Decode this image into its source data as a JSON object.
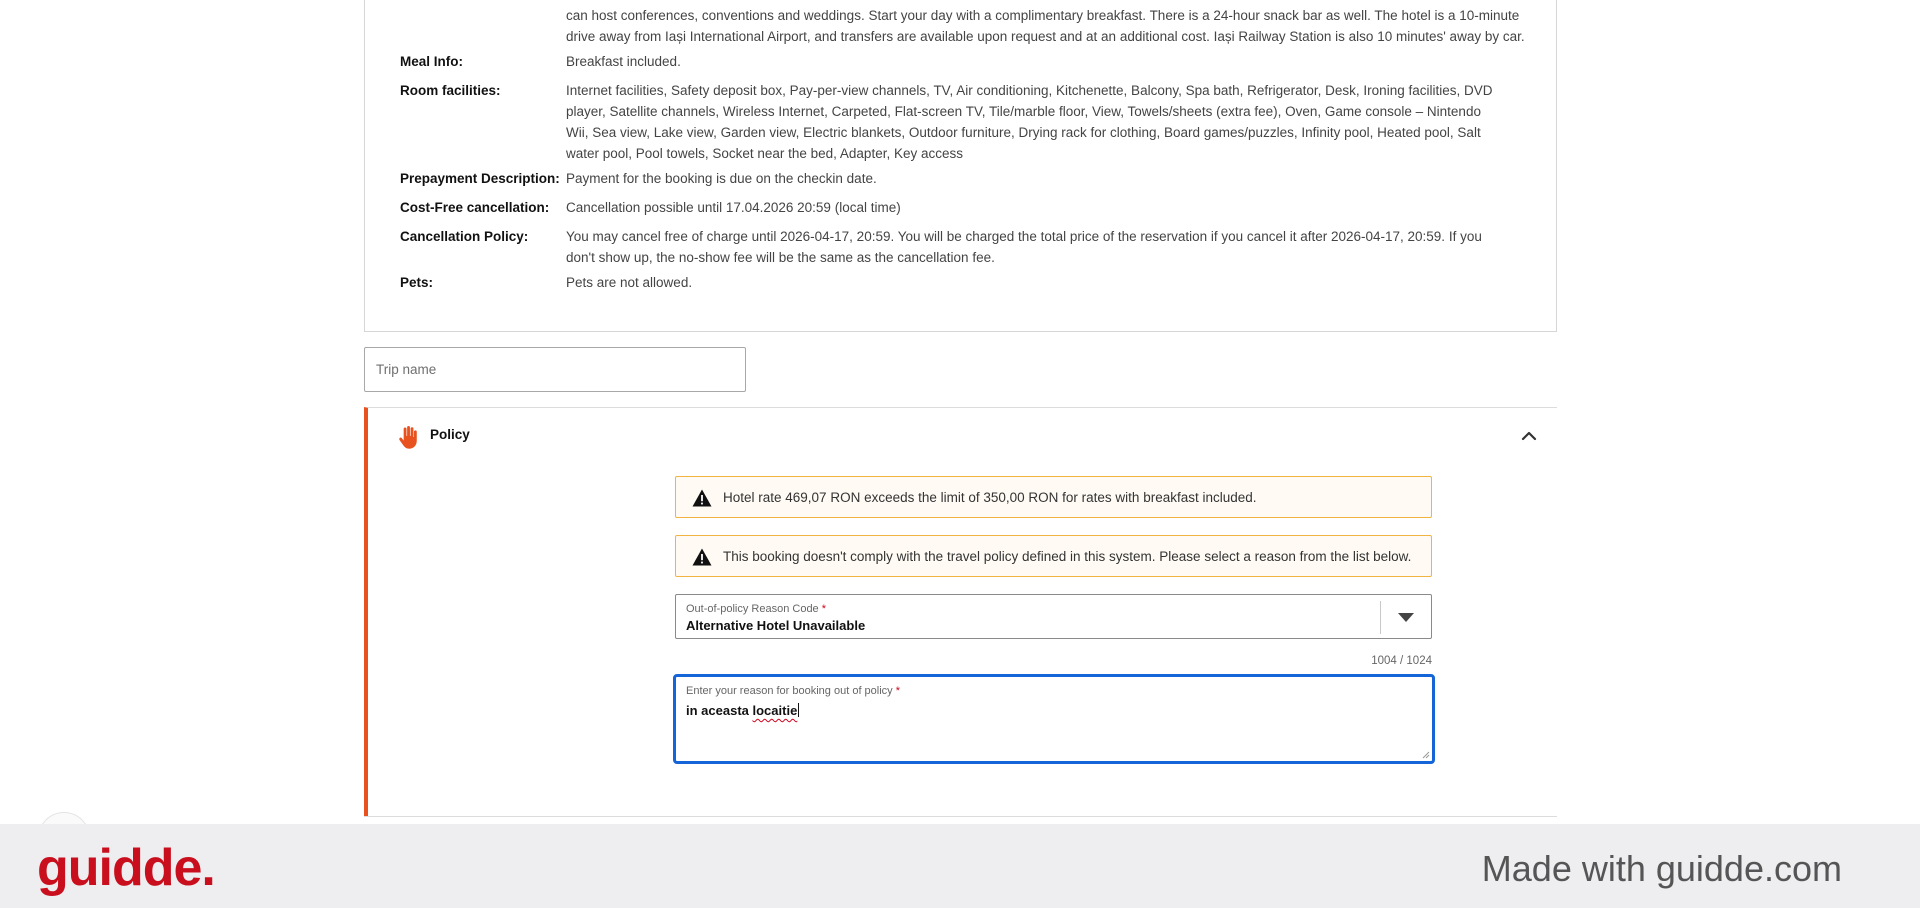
{
  "hotel_details": {
    "description_tail": [
      "can host conferences, conventions and weddings. Start your day with a complimentary breakfast. There is a 24-hour snack bar as well. The hotel is a 10-minute",
      "drive away from Iași International Airport, and transfers are available upon request and at an additional cost. Iași Railway Station is also 10 minutes' away by car."
    ],
    "rows": [
      {
        "label": "Meal Info:",
        "value": "Breakfast included."
      },
      {
        "label": "Room facilities:",
        "value": "Internet facilities, Safety deposit box, Pay-per-view channels, TV, Air conditioning, Kitchenette, Balcony, Spa bath, Refrigerator, Desk, Ironing facilities, DVD player, Satellite channels, Wireless Internet, Carpeted, Flat-screen TV, Tile/marble floor, View, Towels/sheets (extra fee), Oven, Game console – Nintendo Wii, Sea view, Lake view, Garden view, Electric blankets, Outdoor furniture, Drying rack for clothing, Board games/puzzles, Infinity pool, Heated pool, Salt water pool, Pool towels, Socket near the bed, Adapter, Key access"
      },
      {
        "label": "Prepayment Description:",
        "value": "Payment for the booking is due on the checkin date."
      },
      {
        "label": "Cost-Free cancellation:",
        "value": "Cancellation possible until 17.04.2026 20:59 (local time)"
      },
      {
        "label": "Cancellation Policy:",
        "value": "You may cancel free of charge until 2026-04-17, 20:59. You will be charged the total price of the reservation if you cancel it after 2026-04-17, 20:59. If you don't show up, the no-show fee will be the same as the cancellation fee."
      },
      {
        "label": "Pets:",
        "value": "Pets are not allowed."
      }
    ]
  },
  "trip_name": {
    "placeholder": "Trip name",
    "value": ""
  },
  "policy": {
    "title": "Policy",
    "icon": "hand-stop-icon",
    "accent_color": "#e8521f",
    "alerts": [
      {
        "icon": "warning-icon",
        "text": "Hotel rate 469,07 RON exceeds the limit of 350,00 RON for rates with breakfast included."
      },
      {
        "icon": "warning-icon",
        "text": "This booking doesn't comply with the travel policy defined in this system. Please select a reason from the list below."
      }
    ],
    "reason_code": {
      "label": "Out-of-policy Reason Code",
      "required_mark": "*",
      "selected": "Alternative Hotel Unavailable"
    },
    "char_counter": "1004 / 1024",
    "reason_text": {
      "label": "Enter your reason for booking out of policy",
      "required_mark": "*",
      "value_plain": "in aceasta ",
      "value_misspelled": "locaitie"
    }
  },
  "footer": {
    "logo": "guidde.",
    "made_with": "Made with guidde.com",
    "logo_color": "#c90f1d"
  }
}
